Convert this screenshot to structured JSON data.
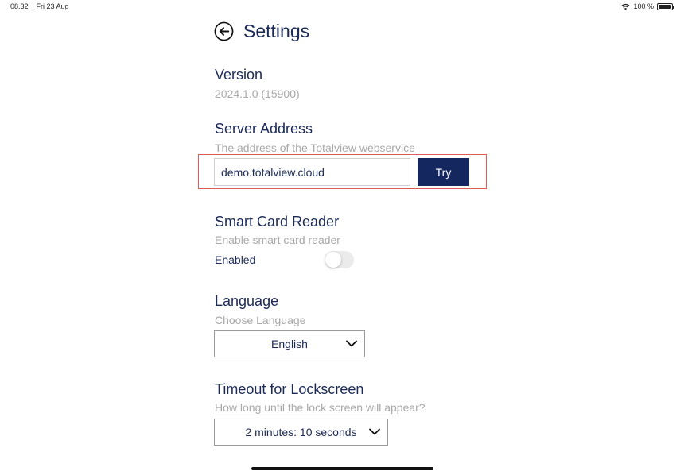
{
  "status_bar": {
    "time": "08.32",
    "date": "Fri 23 Aug",
    "battery": "100 %"
  },
  "header": {
    "title": "Settings"
  },
  "version": {
    "title": "Version",
    "value": "2024.1.0 (15900)"
  },
  "server": {
    "title": "Server Address",
    "subtitle": "The address of the Totalview webservice",
    "value": "demo.totalview.cloud",
    "try_label": "Try",
    "highlight_color": "#e05a57"
  },
  "smart_card": {
    "title": "Smart Card Reader",
    "subtitle": "Enable smart card reader",
    "toggle_label": "Enabled",
    "toggle_on": false
  },
  "language": {
    "title": "Language",
    "subtitle": "Choose Language",
    "selected": "English"
  },
  "timeout": {
    "title": "Timeout for Lockscreen",
    "subtitle": "How long until the lock screen will appear?",
    "selected": "2 minutes: 10 seconds"
  },
  "colors": {
    "primary": "#14275e",
    "text": "#1b2a57",
    "muted": "#a9a9a9"
  }
}
